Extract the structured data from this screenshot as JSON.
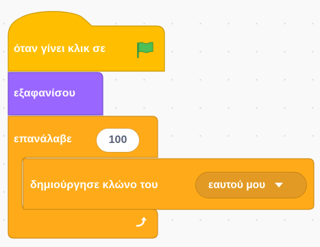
{
  "script": {
    "hat_block": {
      "label": "όταν γίνει κλικ σε",
      "icon": "green-flag-icon"
    },
    "hide_block": {
      "label": "εξαφανίσου"
    },
    "repeat_block": {
      "label": "επανάλαβε",
      "times": "100",
      "loop_icon": "loop-arrow-icon"
    },
    "clone_block": {
      "label": "δημιούργησε κλώνο του",
      "target": "εαυτού μου",
      "dropdown_icon": "caret-down-icon"
    }
  },
  "colors": {
    "events": "#ffbf00",
    "looks": "#9966ff",
    "control": "#ffab19",
    "workspace": "#f9f9f9"
  }
}
